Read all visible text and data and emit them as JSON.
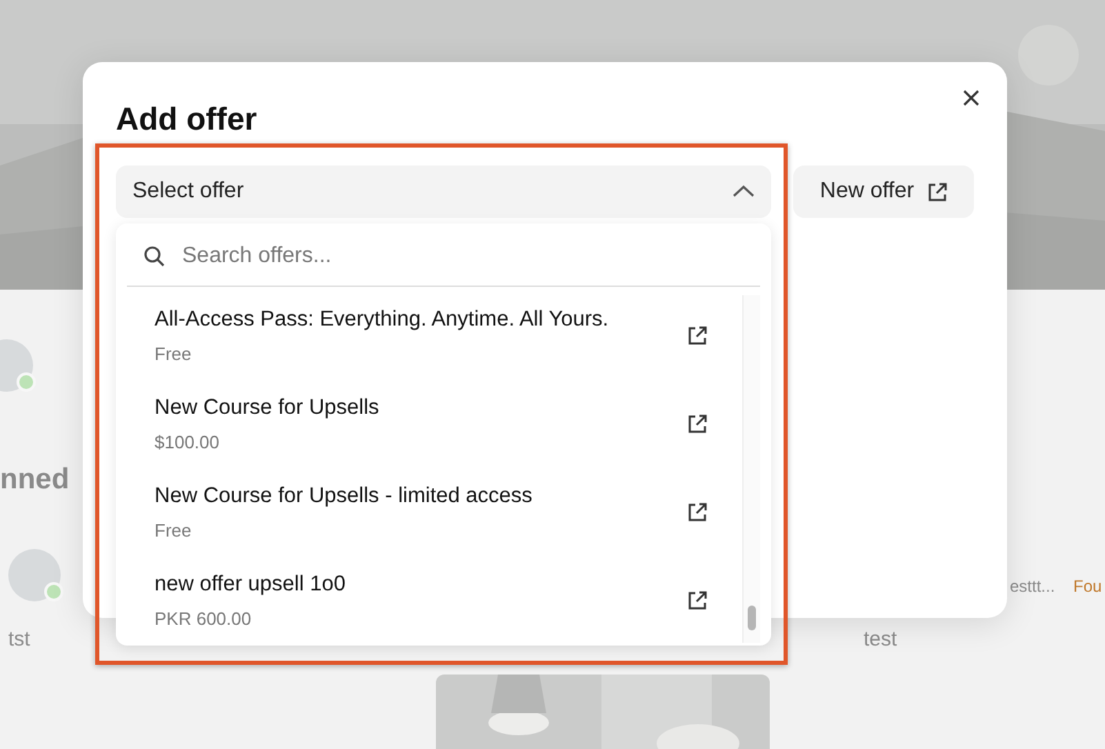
{
  "backdrop": {
    "section_heading": "nned",
    "post_captions": [
      "tst",
      "test"
    ],
    "author_snippet": "esttt...",
    "tag": "Fou"
  },
  "dialog": {
    "title": "Add offer",
    "select": {
      "placeholder": "Select offer",
      "expanded": true
    },
    "new_offer_button": "New offer",
    "search": {
      "placeholder": "Search offers..."
    },
    "offers": [
      {
        "name": "All-Access Pass: Everything. Anytime. All Yours.",
        "price": "Free"
      },
      {
        "name": "New Course for Upsells",
        "price": "$100.00"
      },
      {
        "name": "New Course for Upsells - limited access",
        "price": "Free"
      },
      {
        "name": "new offer upsell 1o0",
        "price": "PKR 600.00"
      }
    ]
  }
}
